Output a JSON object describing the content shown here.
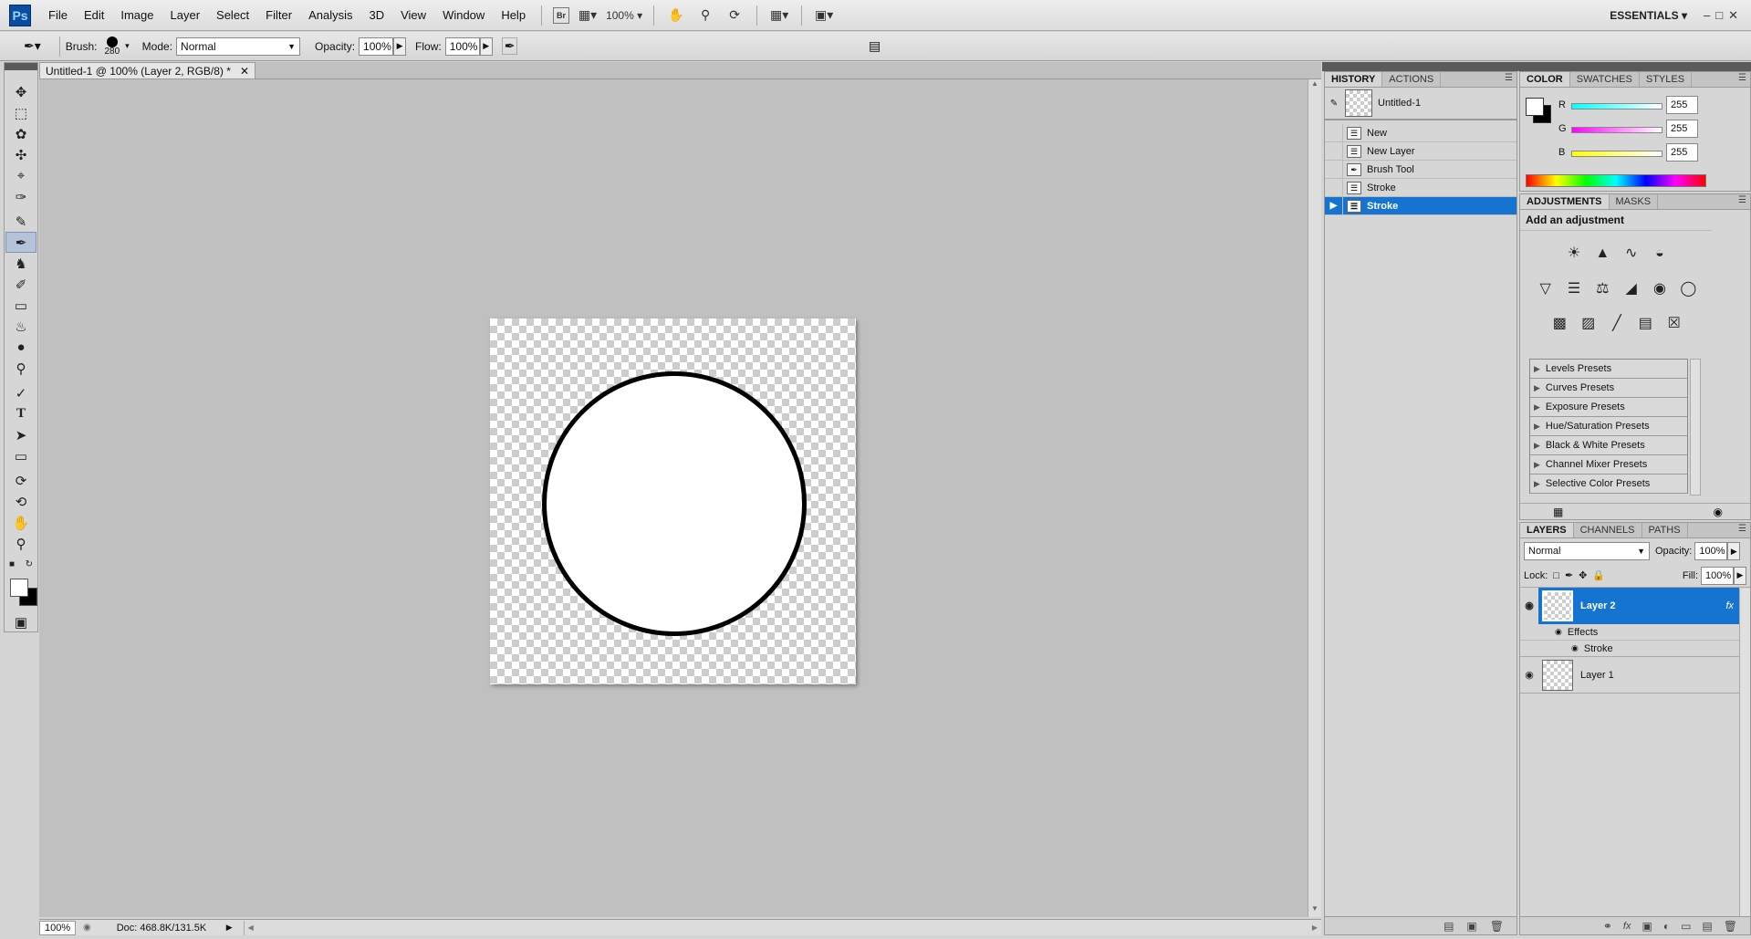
{
  "menubar": {
    "logo": "Ps",
    "items": [
      "File",
      "Edit",
      "Image",
      "Layer",
      "Select",
      "Filter",
      "Analysis",
      "3D",
      "View",
      "Window",
      "Help"
    ],
    "zoom": "100%",
    "workspace": "ESSENTIALS",
    "bridge_label": "Br"
  },
  "options": {
    "brush_label": "Brush:",
    "brush_size": "280",
    "mode_label": "Mode:",
    "mode_value": "Normal",
    "opacity_label": "Opacity:",
    "opacity_value": "100%",
    "flow_label": "Flow:",
    "flow_value": "100%"
  },
  "document": {
    "tab_title": "Untitled-1 @ 100% (Layer 2, RGB/8) *",
    "zoom": "100%",
    "doc_info": "Doc: 468.8K/131.5K"
  },
  "history": {
    "tabs": [
      "HISTORY",
      "ACTIONS"
    ],
    "snapshot": "Untitled-1",
    "states": [
      "New",
      "New Layer",
      "Brush Tool",
      "Stroke",
      "Stroke"
    ],
    "selected_index": 4
  },
  "color": {
    "tabs": [
      "COLOR",
      "SWATCHES",
      "STYLES"
    ],
    "channels": [
      {
        "label": "R",
        "value": "255"
      },
      {
        "label": "G",
        "value": "255"
      },
      {
        "label": "B",
        "value": "255"
      }
    ]
  },
  "adjustments": {
    "tabs": [
      "ADJUSTMENTS",
      "MASKS"
    ],
    "heading": "Add an adjustment",
    "presets": [
      "Levels Presets",
      "Curves Presets",
      "Exposure Presets",
      "Hue/Saturation Presets",
      "Black & White Presets",
      "Channel Mixer Presets",
      "Selective Color Presets"
    ]
  },
  "layers": {
    "tabs": [
      "LAYERS",
      "CHANNELS",
      "PATHS"
    ],
    "blend_mode": "Normal",
    "opacity_label": "Opacity:",
    "opacity_value": "100%",
    "lock_label": "Lock:",
    "fill_label": "Fill:",
    "fill_value": "100%",
    "items": [
      {
        "name": "Layer 2",
        "selected": true,
        "fx": "fx"
      },
      {
        "name": "Layer 1",
        "selected": false
      }
    ],
    "effects_label": "Effects",
    "effect_stroke": "Stroke"
  },
  "colors": {
    "accent": "#1574d2",
    "canvas_bg": "#c0c0c0"
  }
}
